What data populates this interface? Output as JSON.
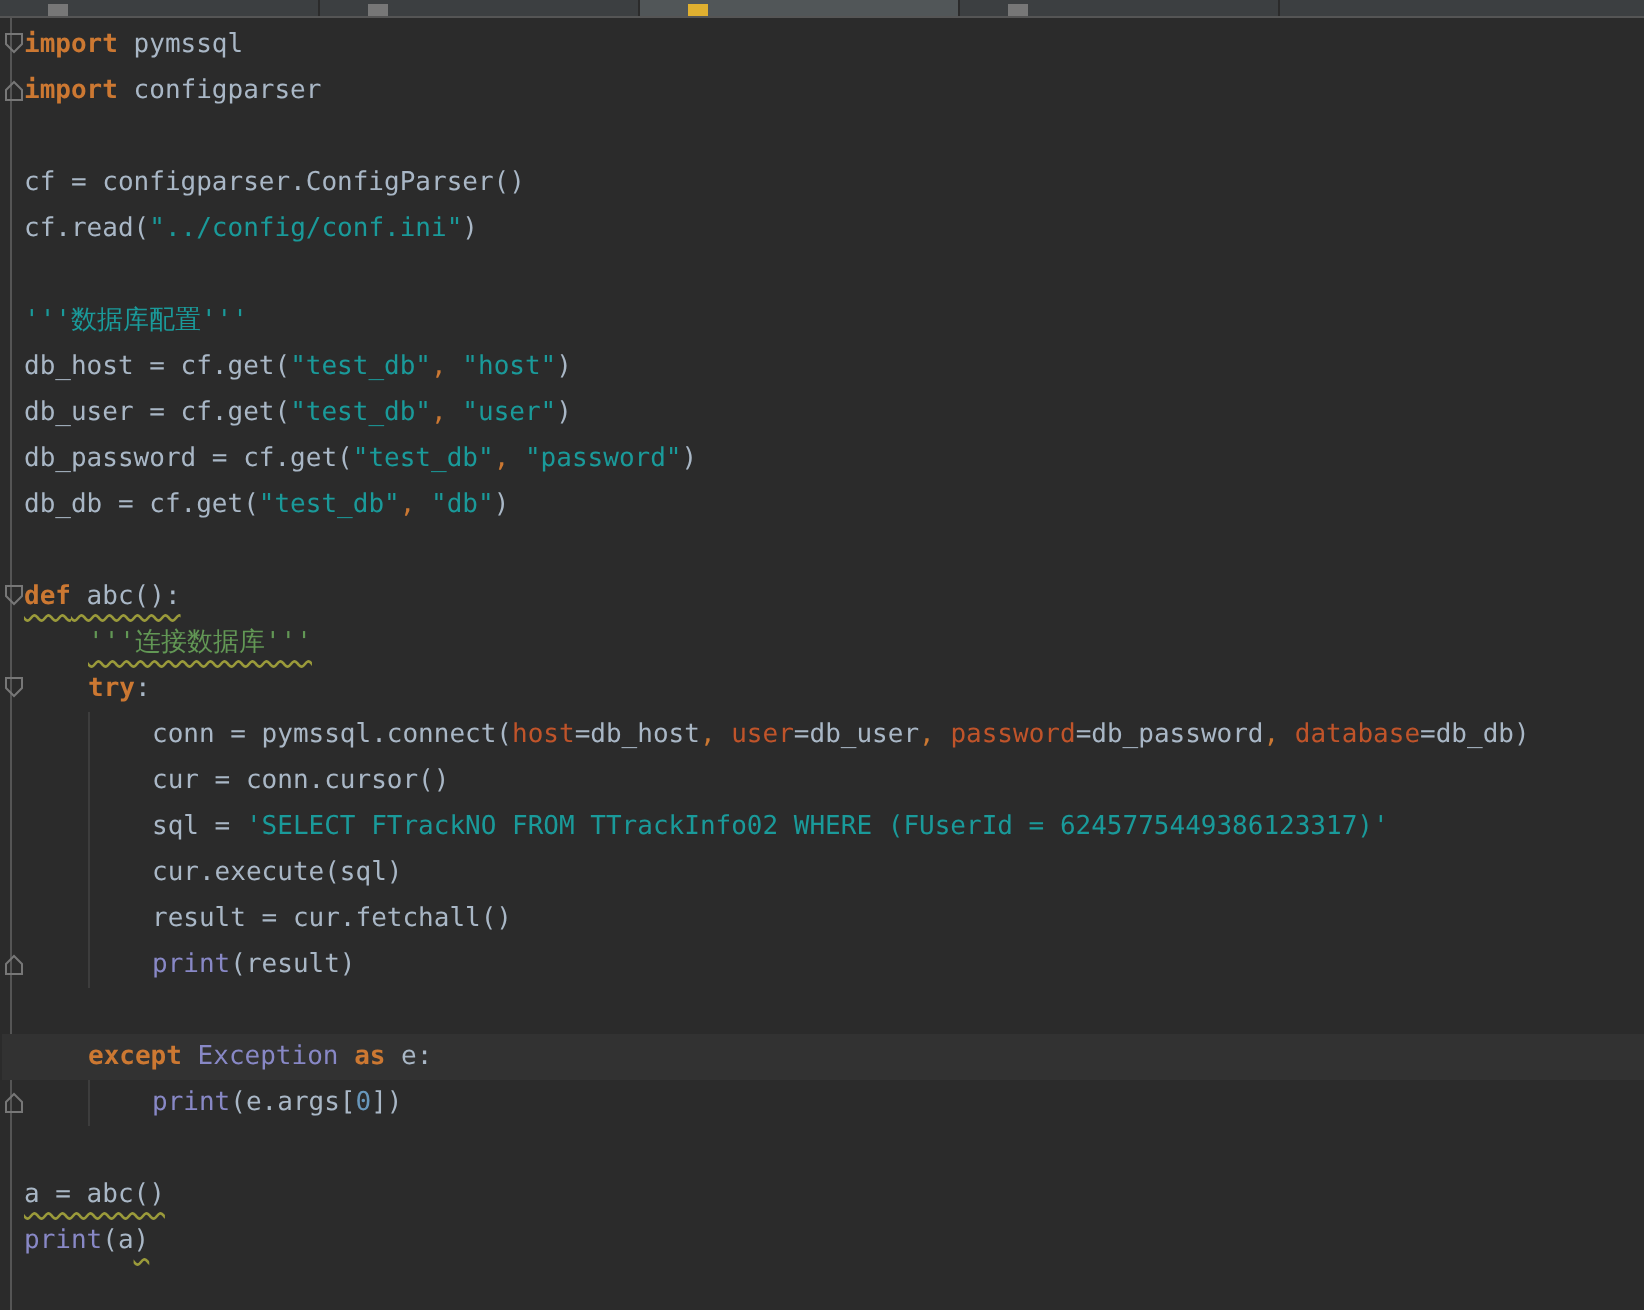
{
  "tabs": [
    {
      "selected": false
    },
    {
      "selected": false
    },
    {
      "selected": true
    },
    {
      "selected": false
    }
  ],
  "lines": [
    {
      "kind": "code",
      "fold_start": true,
      "current": false,
      "tokens": [
        {
          "kind": "keyword",
          "text": "import"
        },
        {
          "kind": "plain",
          "text": " pymssql"
        }
      ]
    },
    {
      "kind": "code",
      "fold_end": true,
      "current": false,
      "tokens": [
        {
          "kind": "keyword",
          "text": "import"
        },
        {
          "kind": "plain",
          "text": " configparser"
        }
      ]
    },
    {
      "kind": "blank",
      "current": false
    },
    {
      "kind": "code",
      "current": false,
      "tokens": [
        {
          "kind": "plain",
          "text": "cf = configparser.ConfigParser()"
        }
      ]
    },
    {
      "kind": "code",
      "current": false,
      "tokens": [
        {
          "kind": "plain",
          "text": "cf.read("
        },
        {
          "kind": "string",
          "text": "\"../config/conf.ini\""
        },
        {
          "kind": "plain",
          "text": ")"
        }
      ]
    },
    {
      "kind": "blank",
      "current": false
    },
    {
      "kind": "code",
      "current": false,
      "tokens": [
        {
          "kind": "string",
          "text": "'''数据库配置'''"
        }
      ]
    },
    {
      "kind": "code",
      "current": false,
      "tokens": [
        {
          "kind": "plain",
          "text": "db_host = cf.get("
        },
        {
          "kind": "string",
          "text": "\"test_db\""
        },
        {
          "kind": "punct",
          "text": ","
        },
        {
          "kind": "string",
          "text": " \"host\""
        },
        {
          "kind": "plain",
          "text": ")"
        }
      ]
    },
    {
      "kind": "code",
      "current": false,
      "tokens": [
        {
          "kind": "plain",
          "text": "db_user = cf.get("
        },
        {
          "kind": "string",
          "text": "\"test_db\""
        },
        {
          "kind": "punct",
          "text": ","
        },
        {
          "kind": "string",
          "text": " \"user\""
        },
        {
          "kind": "plain",
          "text": ")"
        }
      ]
    },
    {
      "kind": "code",
      "current": false,
      "tokens": [
        {
          "kind": "plain",
          "text": "db_password = cf.get("
        },
        {
          "kind": "string",
          "text": "\"test_db\""
        },
        {
          "kind": "punct",
          "text": ","
        },
        {
          "kind": "string",
          "text": " \"password\""
        },
        {
          "kind": "plain",
          "text": ")"
        }
      ]
    },
    {
      "kind": "code",
      "current": false,
      "tokens": [
        {
          "kind": "plain",
          "text": "db_db = cf.get("
        },
        {
          "kind": "string",
          "text": "\"test_db\""
        },
        {
          "kind": "punct",
          "text": ","
        },
        {
          "kind": "string",
          "text": " \"db\""
        },
        {
          "kind": "plain",
          "text": ")"
        }
      ]
    },
    {
      "kind": "blank",
      "current": false
    },
    {
      "kind": "code",
      "fold_start": true,
      "current": false,
      "tokens": [
        {
          "kind": "keyword",
          "text": "def",
          "warning": true
        },
        {
          "kind": "plain",
          "text": " abc():",
          "warning": true
        }
      ]
    },
    {
      "kind": "code",
      "current": false,
      "tokens": [
        {
          "kind": "indent"
        },
        {
          "kind": "docstring",
          "text": "'''连接数据库'''",
          "warning": true
        }
      ]
    },
    {
      "kind": "code",
      "fold_start": true,
      "current": false,
      "tokens": [
        {
          "kind": "indent"
        },
        {
          "kind": "keyword",
          "text": "try"
        },
        {
          "kind": "plain",
          "text": ":"
        }
      ]
    },
    {
      "kind": "code",
      "current": false,
      "tokens": [
        {
          "kind": "indent"
        },
        {
          "kind": "guide"
        },
        {
          "kind": "plain",
          "text": "conn = pymssql.connect("
        },
        {
          "kind": "param",
          "text": "host"
        },
        {
          "kind": "plain",
          "text": "=db_host"
        },
        {
          "kind": "punct",
          "text": ","
        },
        {
          "kind": "param",
          "text": " user"
        },
        {
          "kind": "plain",
          "text": "=db_user"
        },
        {
          "kind": "punct",
          "text": ","
        },
        {
          "kind": "param",
          "text": " password"
        },
        {
          "kind": "plain",
          "text": "=db_password"
        },
        {
          "kind": "punct",
          "text": ","
        },
        {
          "kind": "param",
          "text": " database"
        },
        {
          "kind": "plain",
          "text": "=db_db)"
        }
      ]
    },
    {
      "kind": "code",
      "current": false,
      "tokens": [
        {
          "kind": "indent"
        },
        {
          "kind": "guide"
        },
        {
          "kind": "plain",
          "text": "cur = conn.cursor()"
        }
      ]
    },
    {
      "kind": "code",
      "current": false,
      "tokens": [
        {
          "kind": "indent"
        },
        {
          "kind": "guide"
        },
        {
          "kind": "plain",
          "text": "sql = "
        },
        {
          "kind": "string",
          "text": "'SELECT FTrackNO FROM TTrackInfo02 WHERE (FUserId = 6245775449386123317)'"
        }
      ]
    },
    {
      "kind": "code",
      "current": false,
      "tokens": [
        {
          "kind": "indent"
        },
        {
          "kind": "guide"
        },
        {
          "kind": "plain",
          "text": "cur.execute(sql)"
        }
      ]
    },
    {
      "kind": "code",
      "current": false,
      "tokens": [
        {
          "kind": "indent"
        },
        {
          "kind": "guide"
        },
        {
          "kind": "plain",
          "text": "result = cur.fetchall()"
        }
      ]
    },
    {
      "kind": "code",
      "fold_end": true,
      "current": false,
      "tokens": [
        {
          "kind": "indent"
        },
        {
          "kind": "guide"
        },
        {
          "kind": "builtin",
          "text": "print"
        },
        {
          "kind": "plain",
          "text": "(result)"
        }
      ]
    },
    {
      "kind": "blank",
      "current": false
    },
    {
      "kind": "code",
      "current": true,
      "tokens": [
        {
          "kind": "indent"
        },
        {
          "kind": "keyword",
          "text": "except"
        },
        {
          "kind": "builtin",
          "text": " Exception"
        },
        {
          "kind": "keyword",
          "text": " as"
        },
        {
          "kind": "plain",
          "text": " e:"
        }
      ]
    },
    {
      "kind": "code",
      "fold_end": true,
      "current": false,
      "tokens": [
        {
          "kind": "indent"
        },
        {
          "kind": "guide"
        },
        {
          "kind": "builtin",
          "text": "print"
        },
        {
          "kind": "plain",
          "text": "(e.args["
        },
        {
          "kind": "number",
          "text": "0"
        },
        {
          "kind": "plain",
          "text": "])"
        }
      ]
    },
    {
      "kind": "blank",
      "current": false
    },
    {
      "kind": "code",
      "current": false,
      "tokens": [
        {
          "kind": "plain",
          "text": "a = abc()",
          "warning": true
        }
      ]
    },
    {
      "kind": "code",
      "current": false,
      "tokens": [
        {
          "kind": "builtin",
          "text": "print"
        },
        {
          "kind": "plain",
          "text": "(a"
        },
        {
          "kind": "plain",
          "text": ")",
          "warning": true
        }
      ]
    }
  ]
}
